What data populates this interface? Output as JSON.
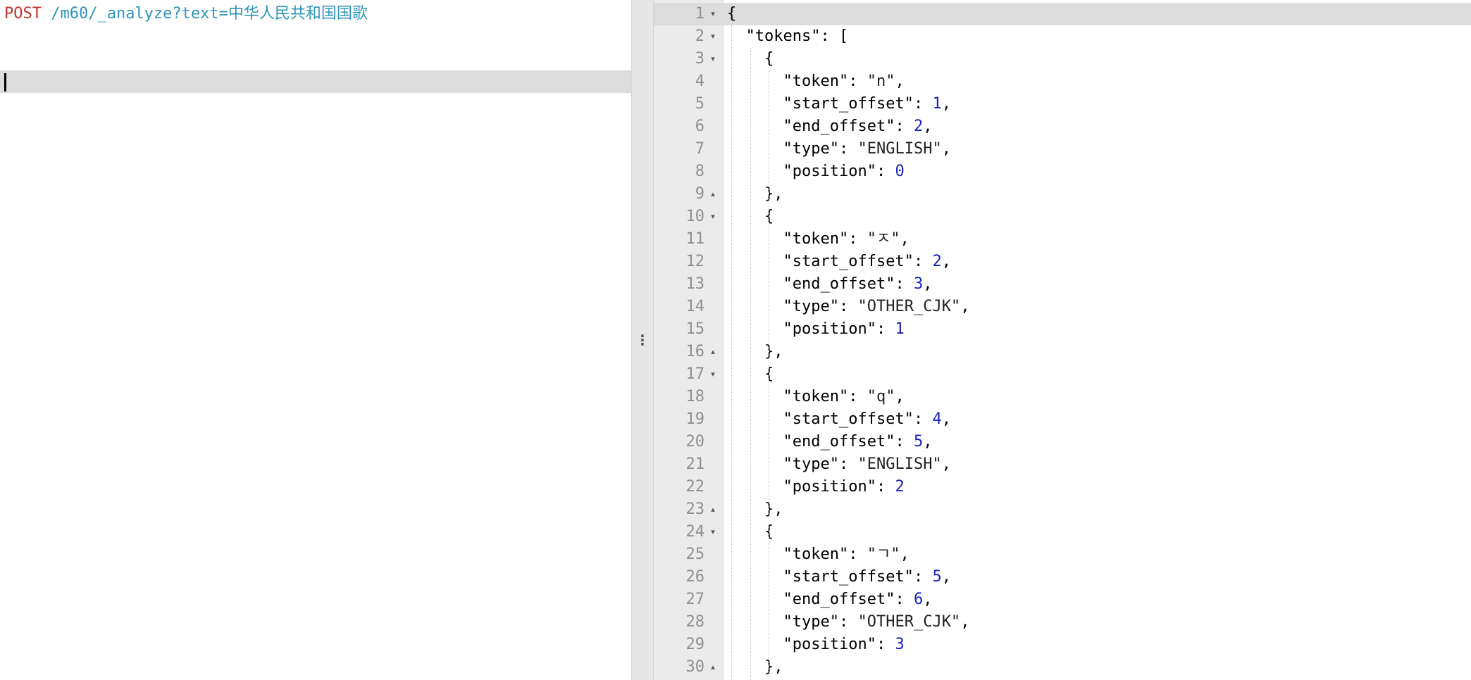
{
  "request": {
    "method": "POST",
    "url": " /m60/_analyze?text=中华人民共和国国歌"
  },
  "resizer": {
    "handle_glyph": "⋮"
  },
  "response": {
    "lines": [
      {
        "num": "1",
        "fold": "▾",
        "indent": 0,
        "parts": [
          [
            "p",
            "{"
          ]
        ]
      },
      {
        "num": "2",
        "fold": "▾",
        "indent": 1,
        "parts": [
          [
            "k",
            "\"tokens\""
          ],
          [
            "p",
            ": ["
          ]
        ]
      },
      {
        "num": "3",
        "fold": "▾",
        "indent": 2,
        "parts": [
          [
            "p",
            "{"
          ]
        ]
      },
      {
        "num": "4",
        "fold": "",
        "indent": 3,
        "parts": [
          [
            "k",
            "\"token\""
          ],
          [
            "p",
            ": "
          ],
          [
            "s",
            "\"n\""
          ],
          [
            "p",
            ","
          ]
        ]
      },
      {
        "num": "5",
        "fold": "",
        "indent": 3,
        "parts": [
          [
            "k",
            "\"start_offset\""
          ],
          [
            "p",
            ": "
          ],
          [
            "n",
            "1"
          ],
          [
            "p",
            ","
          ]
        ]
      },
      {
        "num": "6",
        "fold": "",
        "indent": 3,
        "parts": [
          [
            "k",
            "\"end_offset\""
          ],
          [
            "p",
            ": "
          ],
          [
            "n",
            "2"
          ],
          [
            "p",
            ","
          ]
        ]
      },
      {
        "num": "7",
        "fold": "",
        "indent": 3,
        "parts": [
          [
            "k",
            "\"type\""
          ],
          [
            "p",
            ": "
          ],
          [
            "s",
            "\"ENGLISH\""
          ],
          [
            "p",
            ","
          ]
        ]
      },
      {
        "num": "8",
        "fold": "",
        "indent": 3,
        "parts": [
          [
            "k",
            "\"position\""
          ],
          [
            "p",
            ": "
          ],
          [
            "n",
            "0"
          ]
        ]
      },
      {
        "num": "9",
        "fold": "▴",
        "indent": 2,
        "parts": [
          [
            "p",
            "},"
          ]
        ]
      },
      {
        "num": "10",
        "fold": "▾",
        "indent": 2,
        "parts": [
          [
            "p",
            "{"
          ]
        ]
      },
      {
        "num": "11",
        "fold": "",
        "indent": 3,
        "parts": [
          [
            "k",
            "\"token\""
          ],
          [
            "p",
            ": "
          ],
          [
            "s",
            "\"ㅈ\""
          ],
          [
            "p",
            ","
          ]
        ]
      },
      {
        "num": "12",
        "fold": "",
        "indent": 3,
        "parts": [
          [
            "k",
            "\"start_offset\""
          ],
          [
            "p",
            ": "
          ],
          [
            "n",
            "2"
          ],
          [
            "p",
            ","
          ]
        ]
      },
      {
        "num": "13",
        "fold": "",
        "indent": 3,
        "parts": [
          [
            "k",
            "\"end_offset\""
          ],
          [
            "p",
            ": "
          ],
          [
            "n",
            "3"
          ],
          [
            "p",
            ","
          ]
        ]
      },
      {
        "num": "14",
        "fold": "",
        "indent": 3,
        "parts": [
          [
            "k",
            "\"type\""
          ],
          [
            "p",
            ": "
          ],
          [
            "s",
            "\"OTHER_CJK\""
          ],
          [
            "p",
            ","
          ]
        ]
      },
      {
        "num": "15",
        "fold": "",
        "indent": 3,
        "parts": [
          [
            "k",
            "\"position\""
          ],
          [
            "p",
            ": "
          ],
          [
            "n",
            "1"
          ]
        ]
      },
      {
        "num": "16",
        "fold": "▴",
        "indent": 2,
        "parts": [
          [
            "p",
            "},"
          ]
        ]
      },
      {
        "num": "17",
        "fold": "▾",
        "indent": 2,
        "parts": [
          [
            "p",
            "{"
          ]
        ]
      },
      {
        "num": "18",
        "fold": "",
        "indent": 3,
        "parts": [
          [
            "k",
            "\"token\""
          ],
          [
            "p",
            ": "
          ],
          [
            "s",
            "\"q\""
          ],
          [
            "p",
            ","
          ]
        ]
      },
      {
        "num": "19",
        "fold": "",
        "indent": 3,
        "parts": [
          [
            "k",
            "\"start_offset\""
          ],
          [
            "p",
            ": "
          ],
          [
            "n",
            "4"
          ],
          [
            "p",
            ","
          ]
        ]
      },
      {
        "num": "20",
        "fold": "",
        "indent": 3,
        "parts": [
          [
            "k",
            "\"end_offset\""
          ],
          [
            "p",
            ": "
          ],
          [
            "n",
            "5"
          ],
          [
            "p",
            ","
          ]
        ]
      },
      {
        "num": "21",
        "fold": "",
        "indent": 3,
        "parts": [
          [
            "k",
            "\"type\""
          ],
          [
            "p",
            ": "
          ],
          [
            "s",
            "\"ENGLISH\""
          ],
          [
            "p",
            ","
          ]
        ]
      },
      {
        "num": "22",
        "fold": "",
        "indent": 3,
        "parts": [
          [
            "k",
            "\"position\""
          ],
          [
            "p",
            ": "
          ],
          [
            "n",
            "2"
          ]
        ]
      },
      {
        "num": "23",
        "fold": "▴",
        "indent": 2,
        "parts": [
          [
            "p",
            "},"
          ]
        ]
      },
      {
        "num": "24",
        "fold": "▾",
        "indent": 2,
        "parts": [
          [
            "p",
            "{"
          ]
        ]
      },
      {
        "num": "25",
        "fold": "",
        "indent": 3,
        "parts": [
          [
            "k",
            "\"token\""
          ],
          [
            "p",
            ": "
          ],
          [
            "s",
            "\"ㄱ\""
          ],
          [
            "p",
            ","
          ]
        ]
      },
      {
        "num": "26",
        "fold": "",
        "indent": 3,
        "parts": [
          [
            "k",
            "\"start_offset\""
          ],
          [
            "p",
            ": "
          ],
          [
            "n",
            "5"
          ],
          [
            "p",
            ","
          ]
        ]
      },
      {
        "num": "27",
        "fold": "",
        "indent": 3,
        "parts": [
          [
            "k",
            "\"end_offset\""
          ],
          [
            "p",
            ": "
          ],
          [
            "n",
            "6"
          ],
          [
            "p",
            ","
          ]
        ]
      },
      {
        "num": "28",
        "fold": "",
        "indent": 3,
        "parts": [
          [
            "k",
            "\"type\""
          ],
          [
            "p",
            ": "
          ],
          [
            "s",
            "\"OTHER_CJK\""
          ],
          [
            "p",
            ","
          ]
        ]
      },
      {
        "num": "29",
        "fold": "",
        "indent": 3,
        "parts": [
          [
            "k",
            "\"position\""
          ],
          [
            "p",
            ": "
          ],
          [
            "n",
            "3"
          ]
        ]
      },
      {
        "num": "30",
        "fold": "▴",
        "indent": 2,
        "parts": [
          [
            "p",
            "},"
          ]
        ]
      }
    ]
  },
  "colors": {
    "method": "#c8322f",
    "url": "#2e95b9",
    "number": "#1a23b8",
    "active_line": "#dcdcdc",
    "gutter": "#ebebeb"
  }
}
